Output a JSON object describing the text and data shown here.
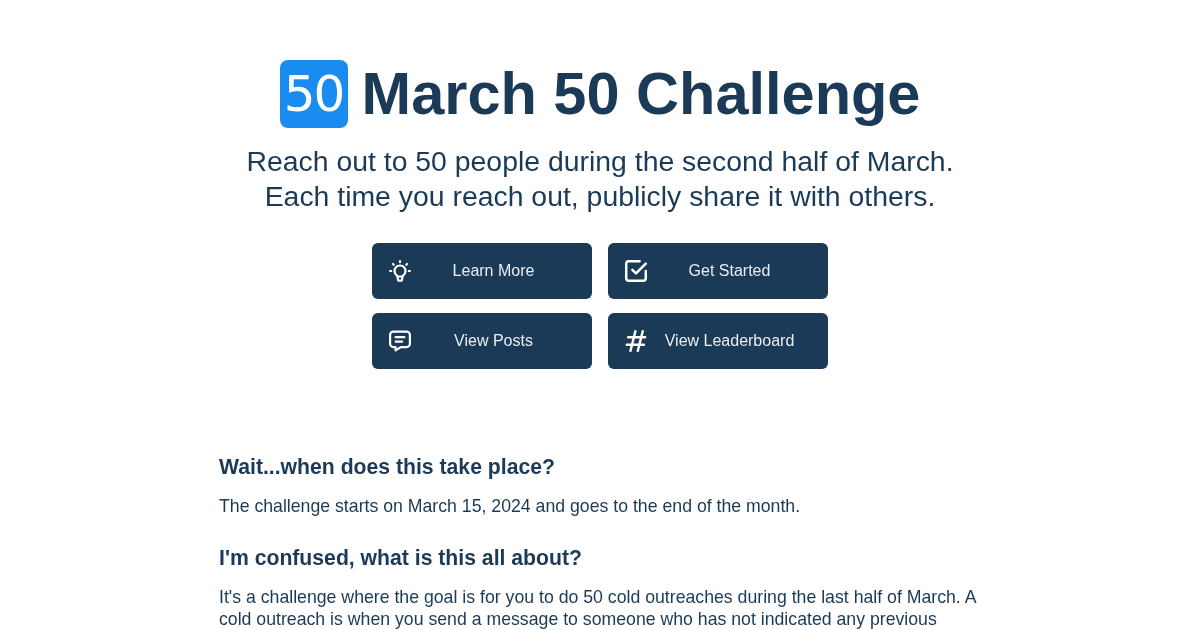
{
  "header": {
    "badge": "50",
    "title": "March 50 Challenge",
    "subtitle": [
      "Reach out to 50 people during the second half of March.",
      "Each time you reach out, publicly share it with others."
    ]
  },
  "buttons": [
    {
      "label": "Learn More",
      "kind": "bulb"
    },
    {
      "label": "Get Started",
      "kind": "check"
    },
    {
      "label": "View Posts",
      "kind": "chat"
    },
    {
      "label": "View Leaderboard",
      "kind": "hash"
    }
  ],
  "faq": [
    {
      "question": "Wait...when does this take place?",
      "answer": "The challenge starts on March 15, 2024 and goes to the end of the month."
    },
    {
      "question": "I'm confused, what is this all about?",
      "answer": "It's a challenge where the goal is for you to do 50 cold outreaches during the last half of March. A cold outreach is when you send a message to someone who has not indicated any previous"
    }
  ]
}
